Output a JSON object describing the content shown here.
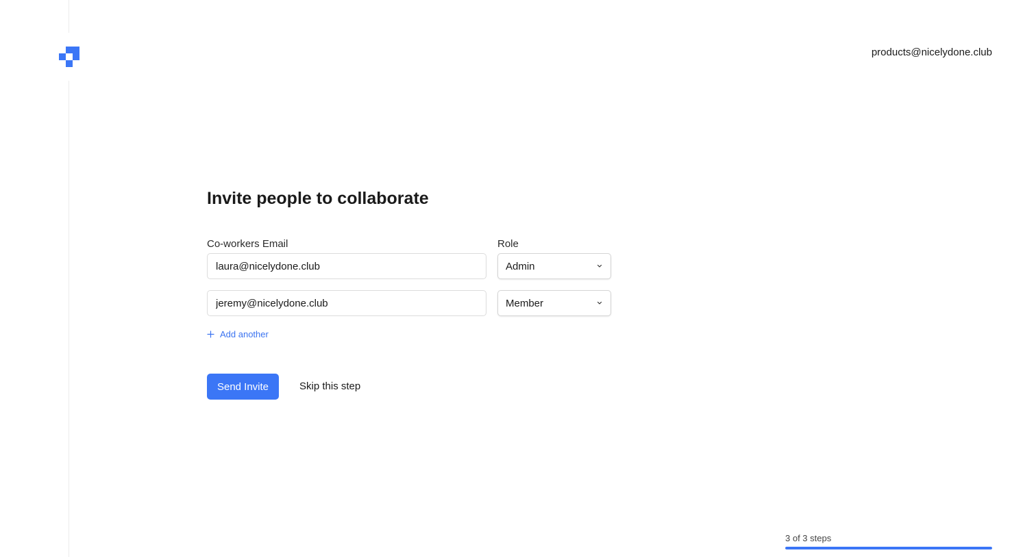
{
  "header": {
    "account_email": "products@nicelydone.club",
    "logo_icon": "pixel-blocks-logo-icon"
  },
  "form": {
    "title": "Invite people to collaborate",
    "email_label": "Co-workers Email",
    "role_label": "Role",
    "invites": [
      {
        "email": "laura@nicelydone.club",
        "role": "Admin"
      },
      {
        "email": "jeremy@nicelydone.club",
        "role": "Member"
      }
    ],
    "add_another_label": "Add another",
    "add_icon": "plus-icon",
    "send_label": "Send Invite",
    "skip_label": "Skip this step"
  },
  "progress": {
    "text": "3 of 3 steps",
    "fraction": 1.0
  },
  "colors": {
    "accent": "#3b76f6",
    "text": "#1a1a1a",
    "border": "#dcdcdc"
  }
}
